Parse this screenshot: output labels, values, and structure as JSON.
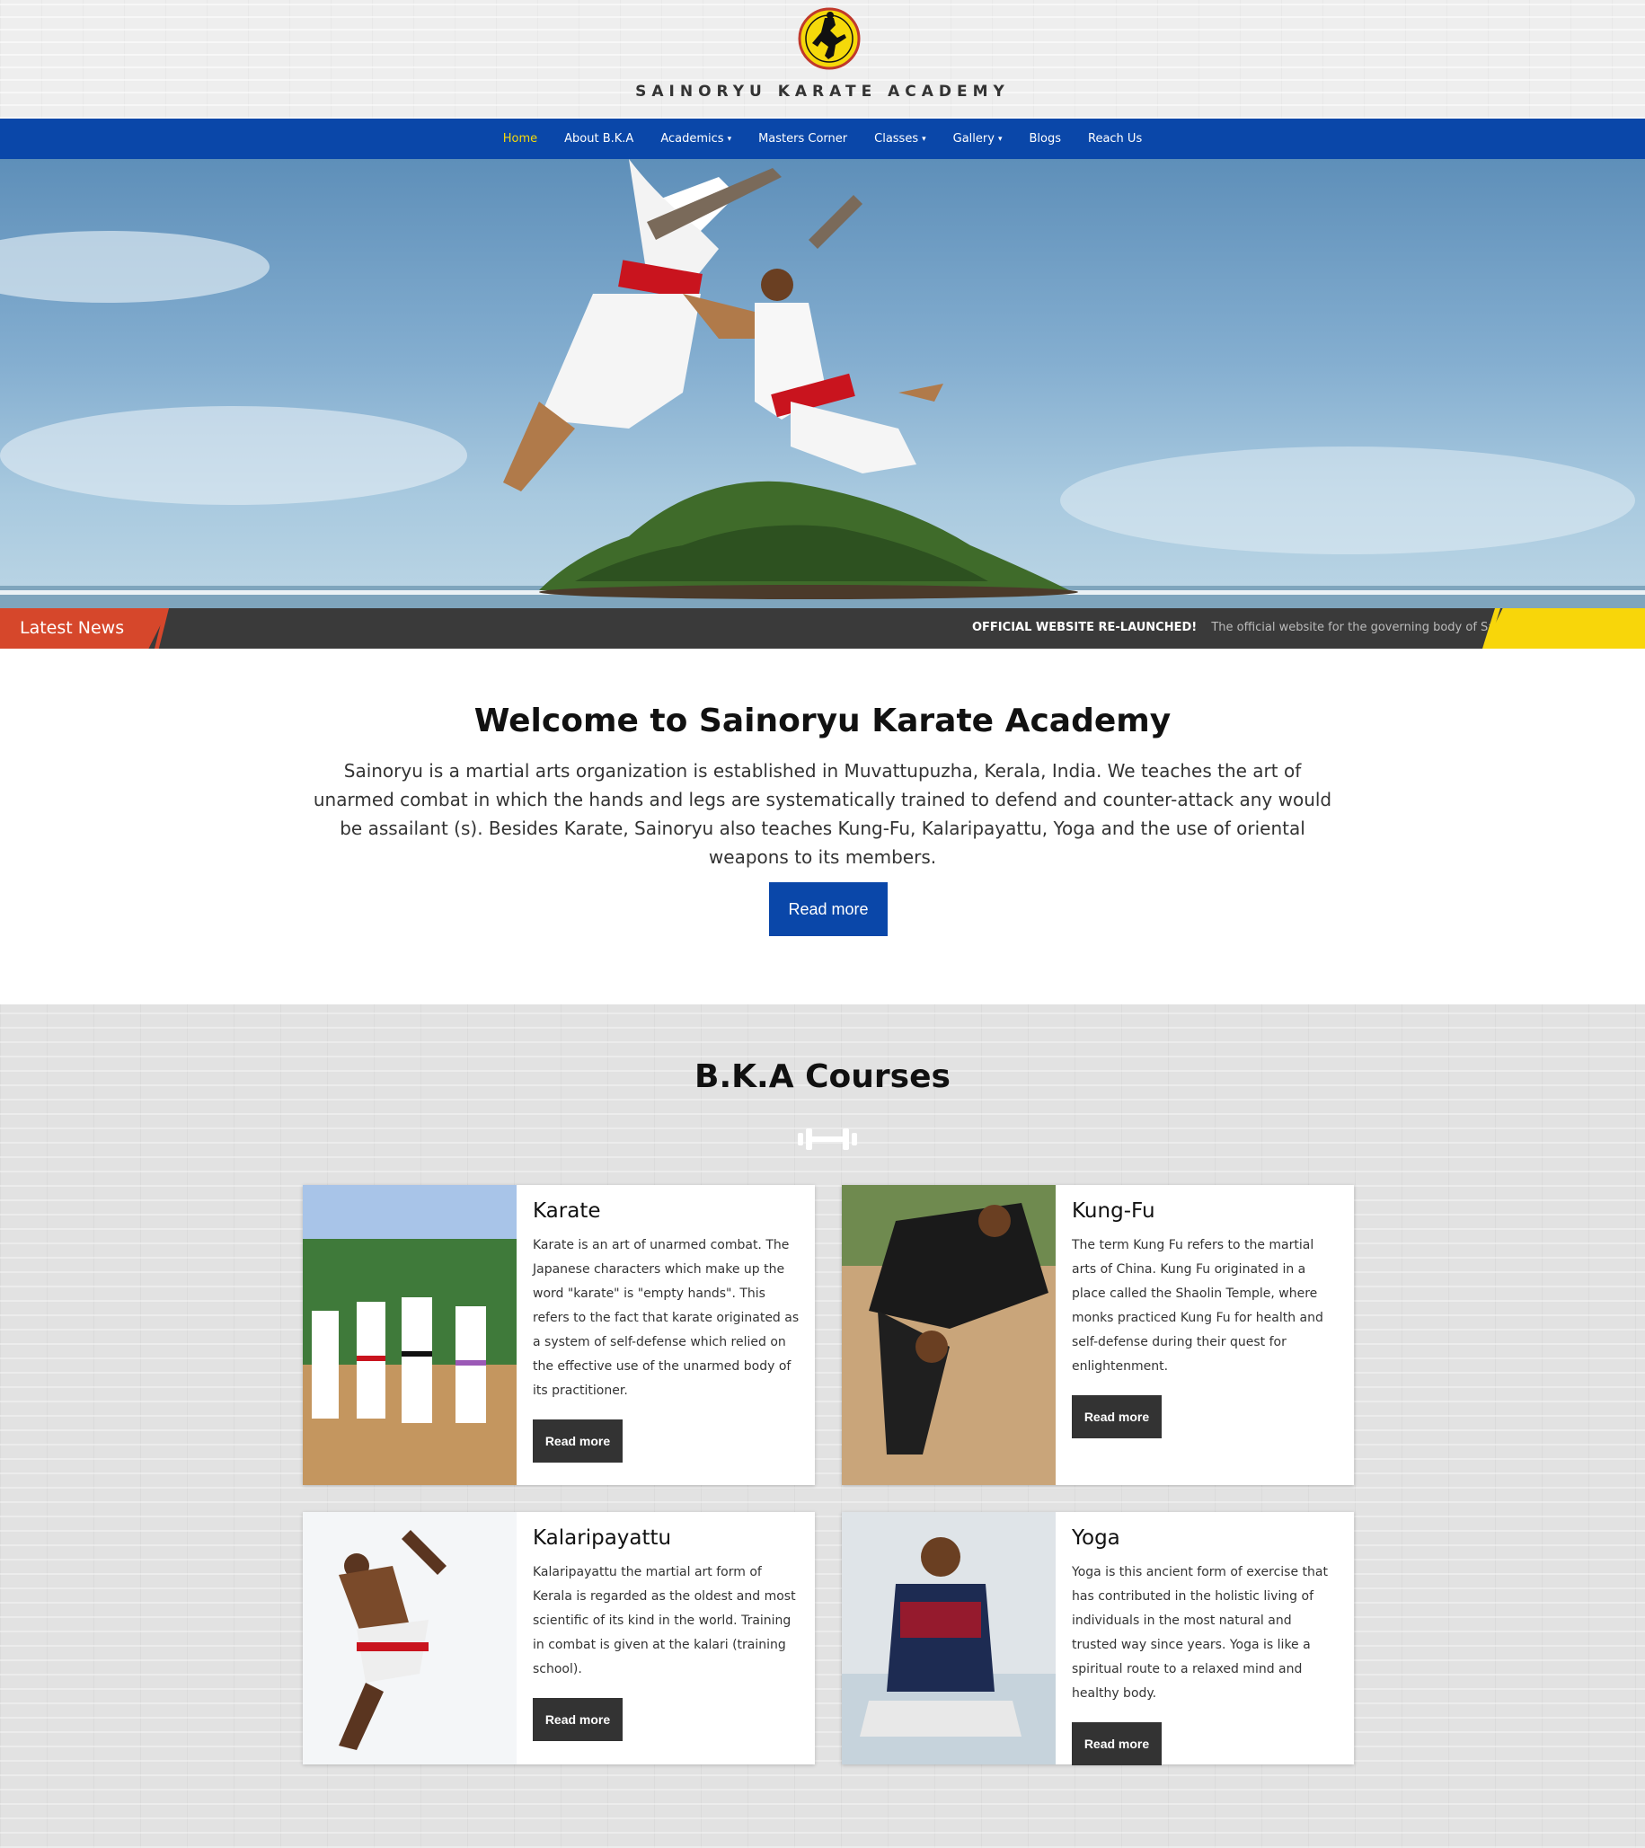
{
  "header": {
    "title": "SAINORYU KARATE ACADEMY",
    "logo_icon": "karate-kick-logo-icon"
  },
  "nav": {
    "items": [
      {
        "label": "Home",
        "active": true,
        "dropdown": false
      },
      {
        "label": "About B.K.A",
        "active": false,
        "dropdown": false
      },
      {
        "label": "Academics",
        "active": false,
        "dropdown": true
      },
      {
        "label": "Masters Corner",
        "active": false,
        "dropdown": false
      },
      {
        "label": "Classes",
        "active": false,
        "dropdown": true
      },
      {
        "label": "Gallery",
        "active": false,
        "dropdown": true
      },
      {
        "label": "Blogs",
        "active": false,
        "dropdown": false
      },
      {
        "label": "Reach Us",
        "active": false,
        "dropdown": false
      }
    ],
    "caret": "▾"
  },
  "ticker": {
    "label": "Latest News",
    "headline": "OFFICIAL WEBSITE RE-LAUNCHED!",
    "text": "The official website for the governing body of Sainoryu"
  },
  "welcome": {
    "title": "Welcome to Sainoryu Karate Academy",
    "body": "Sainoryu is a martial arts organization is established in Muvattupuzha, Kerala, India. We teaches the art of unarmed combat in which the hands and legs are systematically trained to defend and counter-attack any would be assailant (s). Besides Karate, Sainoryu also teaches Kung-Fu, Kalaripayattu, Yoga and the use of oriental weapons to its members.",
    "button": "Read more"
  },
  "courses": {
    "title": "B.K.A Courses",
    "divider_icon": "dumbbell-icon",
    "items": [
      {
        "title": "Karate",
        "text": "Karate is an art of unarmed combat. The Japanese characters which make up the word \"karate\" is \"empty hands\". This refers to the fact that karate originated as a system of self-defense which relied on the effective use of the unarmed body of its practitioner.",
        "button": "Read more"
      },
      {
        "title": "Kung-Fu",
        "text": "The term Kung Fu refers to the martial arts of China. Kung Fu originated in a place called the Shaolin Temple, where monks practiced Kung Fu for health and self-defense during their quest for enlightenment.",
        "button": "Read more"
      },
      {
        "title": "Kalaripayattu",
        "text": "Kalaripayattu the martial art form of Kerala is regarded as the oldest and most scientific of its kind in the world. Training in combat is given at the kalari (training school).",
        "button": "Read more"
      },
      {
        "title": "Yoga",
        "text": "Yoga is this ancient form of exercise that has contributed in the holistic living of individuals in the most natural and trusted way since years. Yoga is like a spiritual route to a relaxed mind and healthy body.",
        "button": "Read more"
      }
    ]
  },
  "colors": {
    "nav_blue": "#0a47a9",
    "nav_active": "#f5d90a",
    "ticker_red": "#d6472b",
    "ticker_yellow": "#f8d60a",
    "button_dark": "#333333"
  }
}
